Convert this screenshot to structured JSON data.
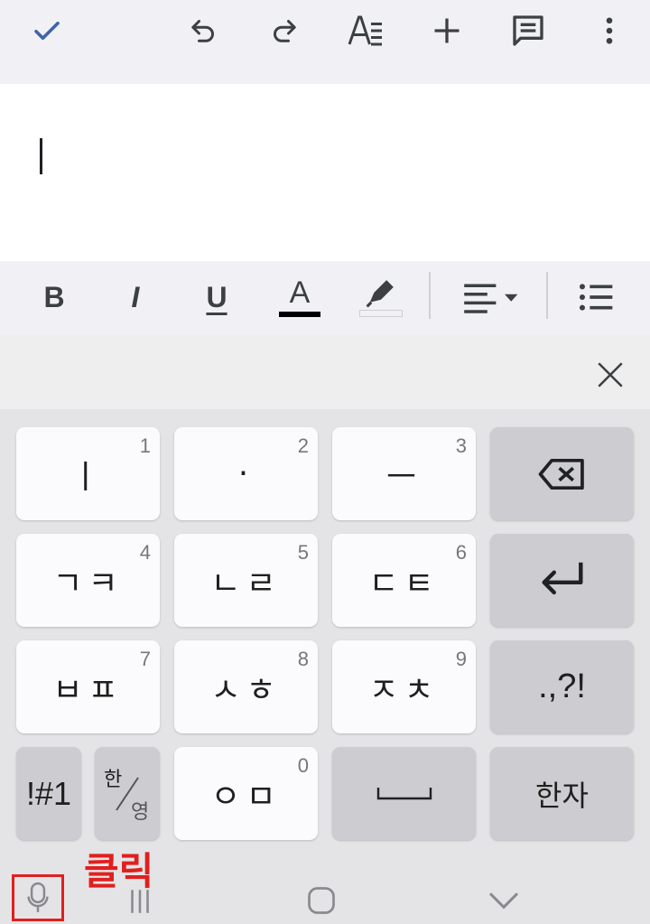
{
  "toolbar": {
    "icons": [
      "check-icon",
      "undo-icon",
      "redo-icon",
      "text-format-icon",
      "plus-icon",
      "comment-icon",
      "more-vert-icon"
    ]
  },
  "format_bar": {
    "bold": "B",
    "italic": "I",
    "underline": "U",
    "text_color": "A",
    "text_color_value": "#000000"
  },
  "keyboard": {
    "rows": [
      [
        {
          "label": "ㅣ",
          "num": "1"
        },
        {
          "label": "·",
          "num": "2"
        },
        {
          "label": "ㅡ",
          "num": "3"
        }
      ],
      [
        {
          "label": "ㄱㅋ",
          "num": "4"
        },
        {
          "label": "ㄴㄹ",
          "num": "5"
        },
        {
          "label": "ㄷㅌ",
          "num": "6"
        }
      ],
      [
        {
          "label": "ㅂㅍ",
          "num": "7"
        },
        {
          "label": "ㅅㅎ",
          "num": "8"
        },
        {
          "label": "ㅈㅊ",
          "num": "9"
        }
      ]
    ],
    "punct_key": ".,?!",
    "symbols_key": "!#1",
    "lang_key_top": "한",
    "lang_key_bottom": "영",
    "zero_key": {
      "label": "ㅇㅁ",
      "num": "0"
    },
    "hanja_key": "한자"
  },
  "annotation": {
    "label": "클릭",
    "color": "#e0201e"
  }
}
